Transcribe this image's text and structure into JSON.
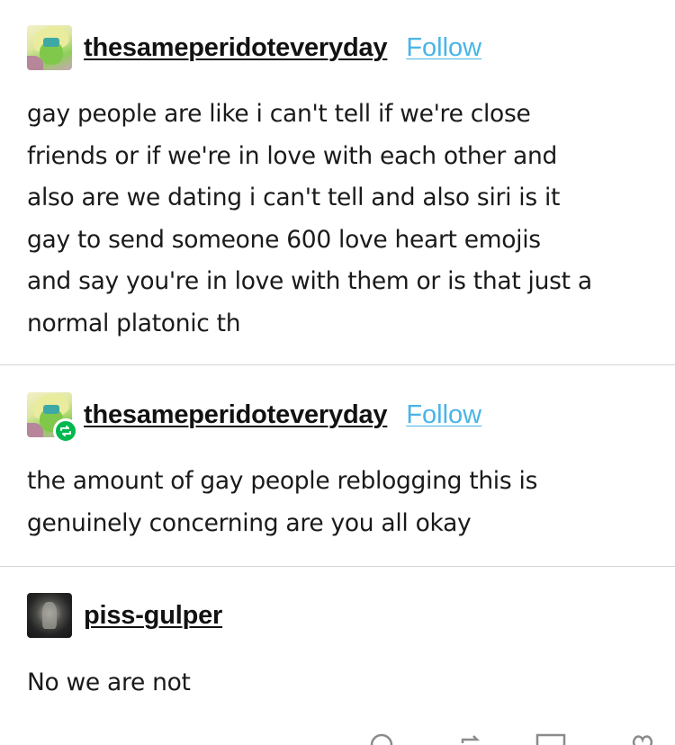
{
  "posts": [
    {
      "username": "thesameperidoteveryday",
      "follow_label": "Follow",
      "avatar": "peridot-avatar",
      "is_reblog": false,
      "body": "gay people are like i can't tell if we're close\nfriends or if we're in love with each other and\nalso are we dating i can't tell and also siri is it\ngay to send someone 600 love heart emojis\nand say you're in love with them or is that just a\nnormal platonic th"
    },
    {
      "username": "thesameperidoteveryday",
      "follow_label": "Follow",
      "avatar": "peridot-avatar",
      "is_reblog": true,
      "reblog_icon": "reblog-icon",
      "body": "the amount of gay people reblogging this is\ngenuinely concerning are you all okay"
    },
    {
      "username": "piss-gulper",
      "avatar": "dark-figure-avatar",
      "is_reblog": false,
      "body": "No we are not"
    }
  ],
  "footer": {
    "icons": [
      "comment-icon",
      "reblog-icon",
      "share-icon",
      "heart-icon"
    ]
  },
  "colors": {
    "follow_link": "#48b5e6",
    "reblog_badge": "#00b84f",
    "divider": "#d4d4d4",
    "text": "#1a1a1a"
  }
}
